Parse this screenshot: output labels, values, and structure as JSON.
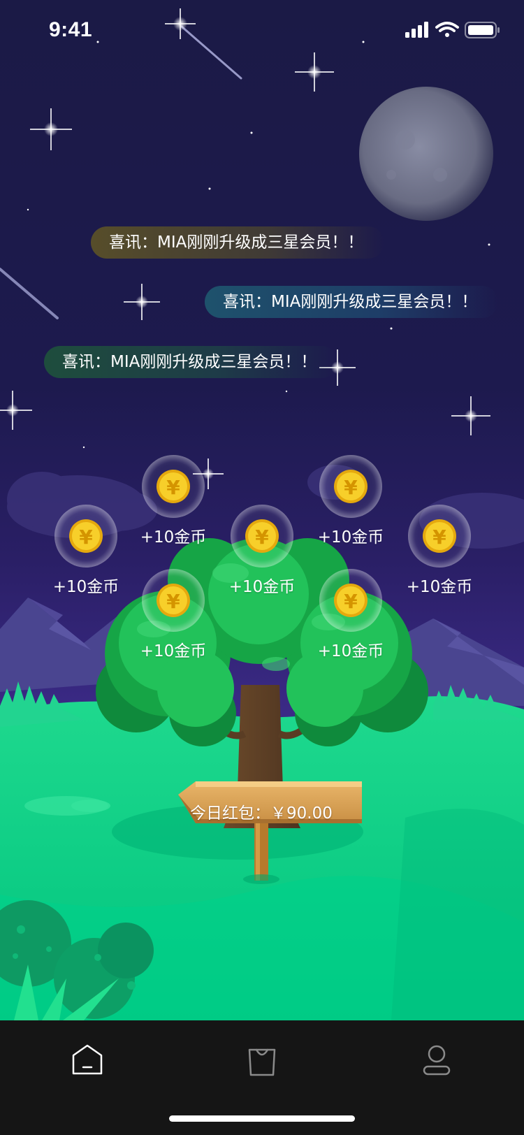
{
  "status_bar": {
    "time": "9:41"
  },
  "notifications": [
    {
      "text": "喜讯：MIA刚刚升级成三星会员！！"
    },
    {
      "text": "喜讯：MIA刚刚升级成三星会员！！"
    },
    {
      "text": "喜讯：MIA刚刚升级成三星会员！！"
    }
  ],
  "coins": [
    {
      "label": "+10金币"
    },
    {
      "label": "+10金币"
    },
    {
      "label": "+10金币"
    },
    {
      "label": "+10金币"
    },
    {
      "label": "+10金币"
    },
    {
      "label": "+10金币"
    },
    {
      "label": "+10金币"
    }
  ],
  "coin_symbol": "¥",
  "signpost": {
    "text": "今日红包：￥90.00"
  },
  "tab_bar": {
    "items": [
      {
        "icon": "home-icon",
        "active": true
      },
      {
        "icon": "shopping-bag-icon",
        "active": false
      },
      {
        "icon": "user-icon",
        "active": false
      }
    ]
  },
  "colors": {
    "sky_top": "#1b1a46",
    "grass": "#00cc84",
    "tree_leaves": "#16b84a",
    "coin_gold": "#f5c518",
    "tab_bar_bg": "#151515",
    "icon_active": "#ffffff",
    "icon_inactive": "#8a8a8a"
  }
}
